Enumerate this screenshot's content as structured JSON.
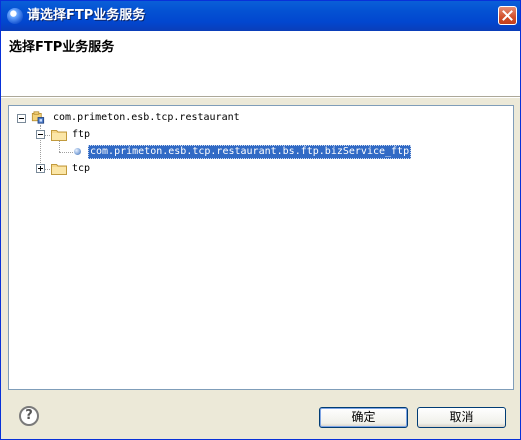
{
  "window": {
    "title": "请选择FTP业务服务",
    "banner_heading": "选择FTP业务服务"
  },
  "tree": {
    "root_label": "com.primeton.esb.tcp.restaurant",
    "folder_ftp_label": "ftp",
    "service_label": "com.primeton.esb.tcp.restaurant.bs.ftp.bizService_ftp",
    "folder_tcp_label": "tcp"
  },
  "footer": {
    "help_glyph": "?",
    "ok_label": "确定",
    "cancel_label": "取消"
  },
  "colors": {
    "titlebar": "#0453d3",
    "selection": "#316ac5",
    "dialog_bg": "#ece9d8"
  },
  "icons": [
    "app-icon",
    "close-icon",
    "project-icon",
    "folder-icon",
    "service-icon",
    "help-icon"
  ]
}
